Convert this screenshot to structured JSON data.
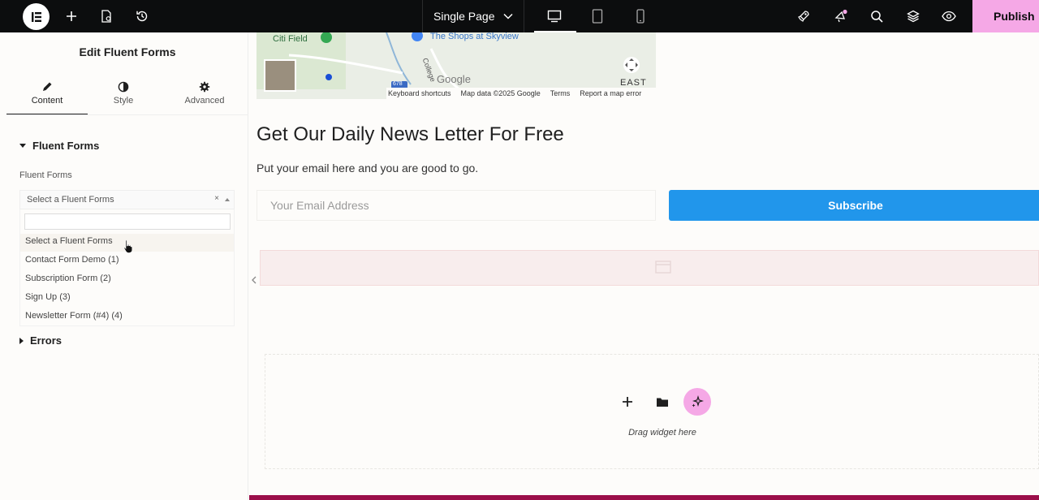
{
  "topbar": {
    "page_name": "Single Page",
    "publish_label": "Publish"
  },
  "panel": {
    "title": "Edit Fluent Forms",
    "tabs": [
      {
        "label": "Content",
        "icon": "pencil-icon"
      },
      {
        "label": "Style",
        "icon": "half-circle-icon"
      },
      {
        "label": "Advanced",
        "icon": "gear-icon"
      }
    ],
    "section_fluent": "Fluent Forms",
    "field_label": "Fluent Forms",
    "select_value": "Select a Fluent Forms",
    "select_clear": "×",
    "options": [
      "Select a Fluent Forms",
      "Contact Form Demo (1)",
      "Subscription Form (2)",
      "Sign Up (3)",
      "Newsletter Form (#4) (4)"
    ],
    "section_errors": "Errors"
  },
  "map": {
    "place_1": "Citi Field",
    "place_2": "The Shops at Skyview",
    "road": "College",
    "road_shield": "678",
    "google": "Google",
    "east": "EAST F",
    "footer": {
      "shortcuts": "Keyboard shortcuts",
      "data": "Map data ©2025 Google",
      "terms": "Terms",
      "report": "Report a map error"
    }
  },
  "newsletter": {
    "heading": "Get Our Daily News Letter For Free",
    "subtext": "Put your email here and you are good to go.",
    "email_placeholder": "Your Email Address",
    "subscribe_label": "Subscribe"
  },
  "drop_zone": {
    "text": "Drag widget here"
  },
  "colors": {
    "publish": "#f5a8e6",
    "subscribe": "#2196eb",
    "topbar": "#0c0d0e",
    "footer_bar": "#9b0f4a"
  }
}
